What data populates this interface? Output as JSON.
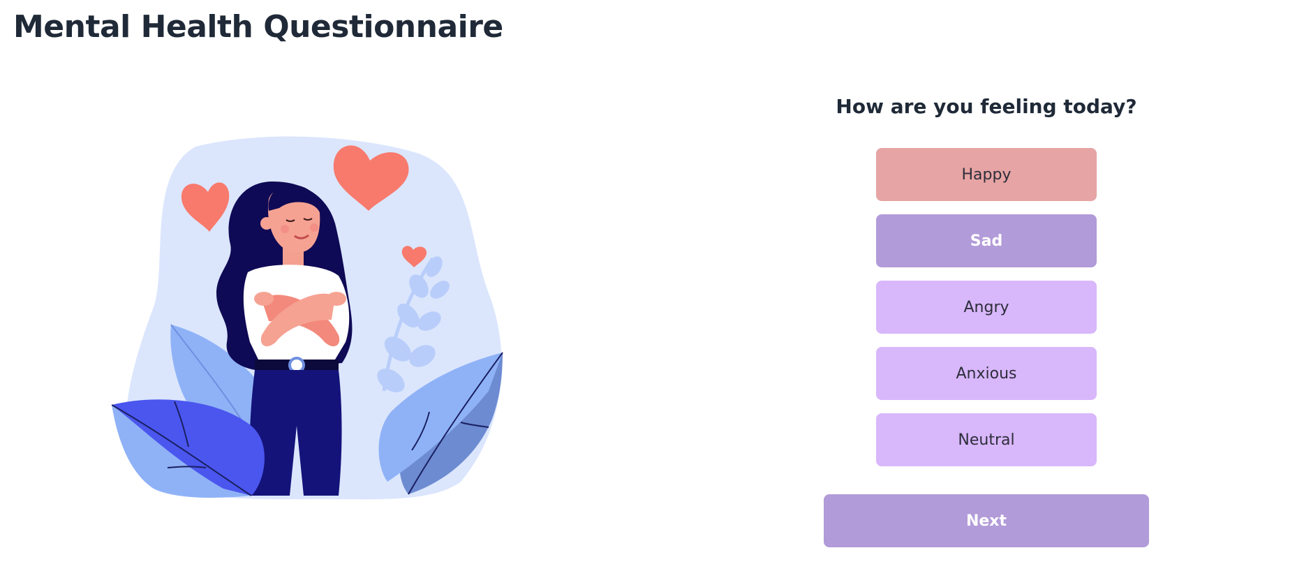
{
  "page": {
    "title": "Mental Health Questionnaire"
  },
  "illustration": {
    "subject": "woman-hugging-herself-icon"
  },
  "question": {
    "text": "How are you feeling today?",
    "options": [
      {
        "label": "Happy"
      },
      {
        "label": "Sad"
      },
      {
        "label": "Angry"
      },
      {
        "label": "Anxious"
      },
      {
        "label": "Neutral"
      }
    ],
    "selected": "Sad"
  },
  "actions": {
    "next_label": "Next"
  },
  "colors": {
    "happy": "#e6a4a4",
    "selected": "#b29bd9",
    "option": "#d8b7fb",
    "next": "#b29bd9",
    "title_text": "#1f2937",
    "blob": "#dbe6fd",
    "heart": "#f87a6c"
  }
}
